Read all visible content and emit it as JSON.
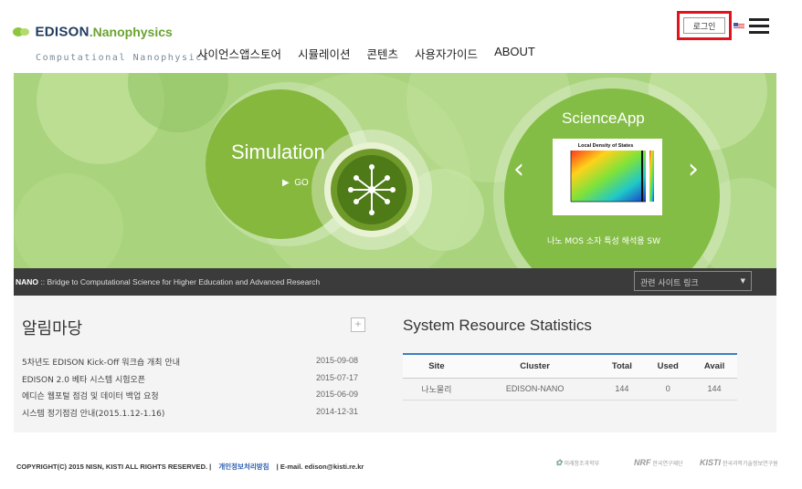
{
  "header": {
    "logo_brand": "EDISON",
    "logo_suffix": "Nanophysics",
    "logo_sub": "Computational Nanophysics",
    "nav": [
      "사이언스앱스토어",
      "시뮬레이션",
      "콘텐츠",
      "사용자가이드",
      "ABOUT"
    ],
    "login_label": "로그인"
  },
  "banner": {
    "simulation_title": "Simulation",
    "simulation_go": "GO",
    "scienceapp_title": "ScienceApp",
    "scienceapp_caption": "나노 MOS 소자 특성 해석용 SW",
    "plot_title": "Local Density of States",
    "prev_arrow": "‹",
    "next_arrow": "›"
  },
  "strip": {
    "label": "NANO",
    "tagline": " :: Bridge to Computational Science for Higher Education and Advanced Research",
    "site_link": "관련 사이트 링크"
  },
  "notice": {
    "title": "알림마당",
    "plus": "+",
    "items": [
      {
        "title": "5차년도 EDISON Kick-Off 워크숍 개최 안내",
        "date": "2015-09-08"
      },
      {
        "title": "EDISON 2.0 베타 시스템 시험오픈",
        "date": "2015-07-17"
      },
      {
        "title": "에디슨 웹포털 점검 및 데이터 백업 요청",
        "date": "2015-06-09"
      },
      {
        "title": "시스템 정기점검 안내(2015.1.12-1.16)",
        "date": "2014-12-31"
      }
    ]
  },
  "stats": {
    "title": "System Resource Statistics",
    "headers": [
      "Site",
      "Cluster",
      "Total",
      "Used",
      "Avail"
    ],
    "rows": [
      [
        "나노물리",
        "EDISON-NANO",
        "144",
        "0",
        "144"
      ]
    ]
  },
  "footer": {
    "copyright": "COPYRIGHT(C) 2015 NISN, KISTI ALL RIGHTS RESERVED.  |",
    "privacy": "개인정보처리방침",
    "email": "|   E-mail. edison@kisti.re.kr",
    "partners": [
      {
        "mark": "✿",
        "name": "미래창조과학부"
      },
      {
        "mark": "NRF",
        "name": "한국연구재단"
      },
      {
        "mark": "KISTI",
        "name": "한국과학기술정보연구원"
      }
    ]
  },
  "colors": {
    "banner_green": "#a9d37c",
    "dark_green": "#5a8a2a",
    "login_highlight": "#e0141e",
    "table_accent": "#3d7fc2"
  },
  "icons": [
    "leaf-logo-icon",
    "flag-icon",
    "hamburger-icon",
    "molecule-icon",
    "play-icon",
    "chevron-left-icon",
    "chevron-right-icon",
    "caret-down-icon"
  ]
}
